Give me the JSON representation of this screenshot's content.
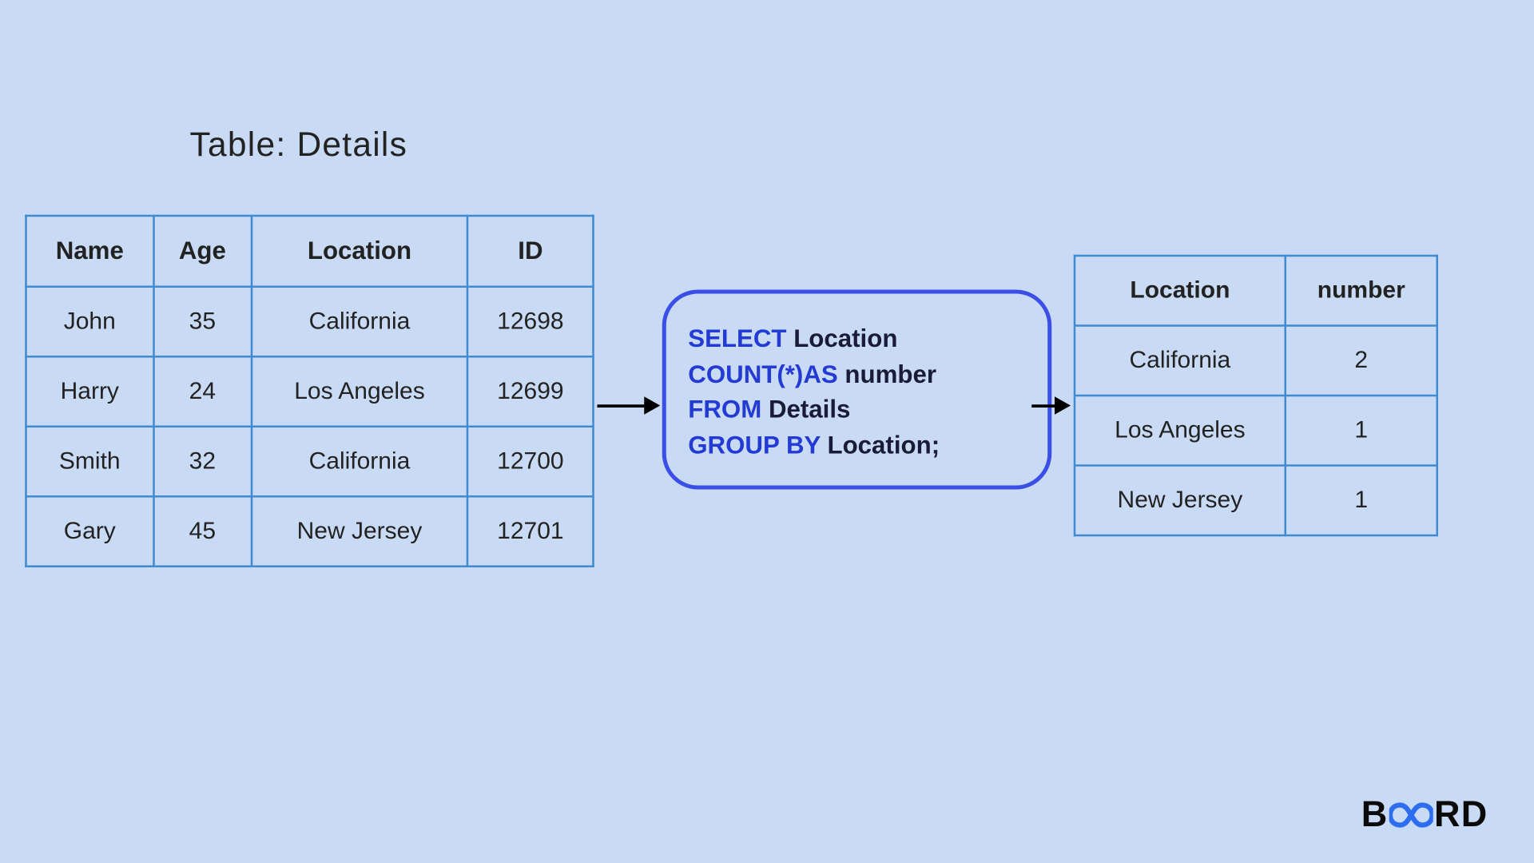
{
  "title": "Table: Details",
  "left_table": {
    "headers": [
      "Name",
      "Age",
      "Location",
      "ID"
    ],
    "rows": [
      [
        "John",
        "35",
        "California",
        "12698"
      ],
      [
        "Harry",
        "24",
        "Los Angeles",
        "12699"
      ],
      [
        "Smith",
        "32",
        "California",
        "12700"
      ],
      [
        "Gary",
        "45",
        "New Jersey",
        "12701"
      ]
    ]
  },
  "right_table": {
    "headers": [
      "Location",
      "number"
    ],
    "rows": [
      [
        "California",
        "2"
      ],
      [
        "Los Angeles",
        "1"
      ],
      [
        "New Jersey",
        "1"
      ]
    ]
  },
  "sql": {
    "kw_select": "SELECT",
    "txt_select": "  Location",
    "kw_count": "COUNT(*)AS",
    "txt_count": " number",
    "kw_from": "FROM",
    "txt_from": " Details",
    "kw_group": "GROUP BY",
    "txt_group": " Location;"
  },
  "brand": {
    "part1": "B",
    "part2": "RD"
  },
  "chart_data": {
    "type": "table",
    "input_table": {
      "name": "Details",
      "columns": [
        "Name",
        "Age",
        "Location",
        "ID"
      ],
      "rows": [
        {
          "Name": "John",
          "Age": 35,
          "Location": "California",
          "ID": 12698
        },
        {
          "Name": "Harry",
          "Age": 24,
          "Location": "Los Angeles",
          "ID": 12699
        },
        {
          "Name": "Smith",
          "Age": 32,
          "Location": "California",
          "ID": 12700
        },
        {
          "Name": "Gary",
          "Age": 45,
          "Location": "New Jersey",
          "ID": 12701
        }
      ]
    },
    "query": "SELECT Location COUNT(*)AS number FROM Details GROUP BY Location;",
    "output_table": {
      "columns": [
        "Location",
        "number"
      ],
      "rows": [
        {
          "Location": "California",
          "number": 2
        },
        {
          "Location": "Los Angeles",
          "number": 1
        },
        {
          "Location": "New Jersey",
          "number": 1
        }
      ]
    }
  }
}
